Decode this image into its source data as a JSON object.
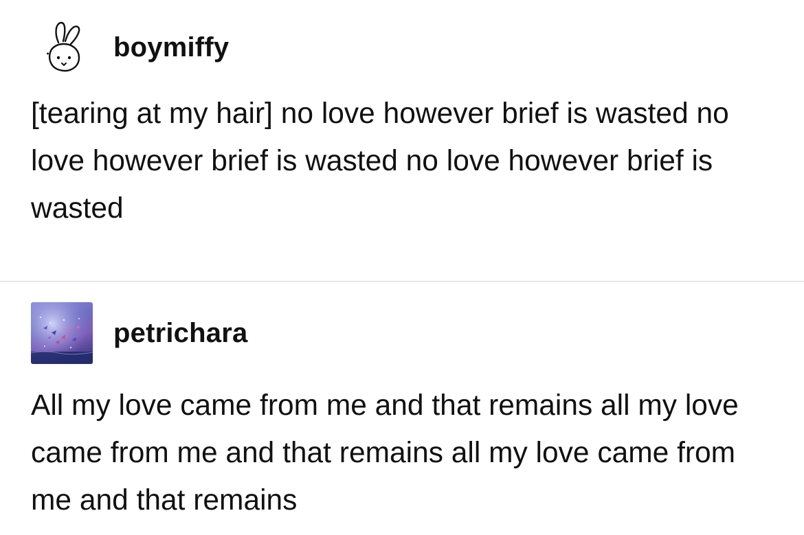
{
  "posts": [
    {
      "username": "boymiffy",
      "avatar_icon": "miffy-bunny-icon",
      "text": "[tearing at my hair] no love however brief is wasted no love however brief is wasted no love however brief is wasted"
    },
    {
      "username": "petrichara",
      "avatar_icon": "butterflies-photo-avatar",
      "text": "All my love came from me and that remains all my love came from me and that remains all my love came from me and that remains"
    }
  ],
  "colors": {
    "text": "#111111",
    "divider": "#d6d6d6",
    "background": "#ffffff"
  }
}
